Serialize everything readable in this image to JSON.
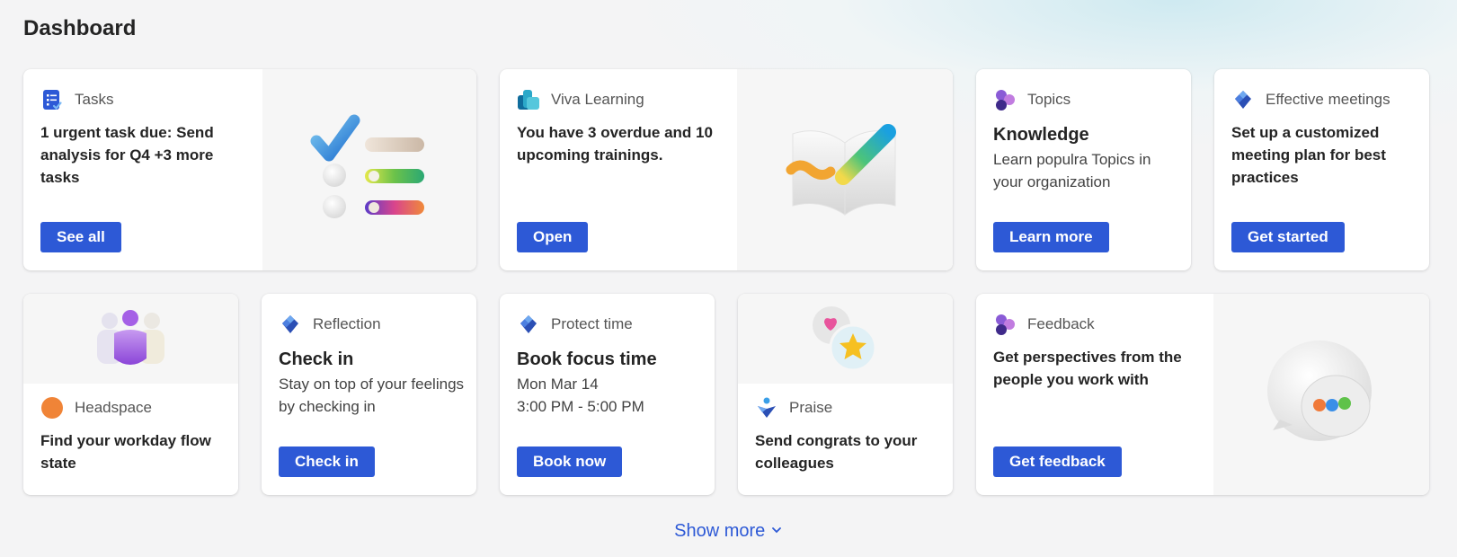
{
  "page": {
    "title": "Dashboard",
    "show_more": "Show more"
  },
  "colors": {
    "accent": "#2d59d6",
    "background": "#f4f4f5"
  },
  "cards": {
    "tasks": {
      "icon": "tasks-checklist-icon",
      "label": "Tasks",
      "text": "1 urgent task due: Send analysis for Q4 +3 more tasks",
      "button": "See all"
    },
    "viva": {
      "icon": "viva-learning-icon",
      "label": "Viva Learning",
      "text": "You have 3 overdue and 10 upcoming trainings.",
      "button": "Open"
    },
    "topics": {
      "icon": "topics-icon",
      "label": "Topics",
      "heading": "Knowledge",
      "text": "Learn populra Topics in your organization",
      "button": "Learn more"
    },
    "meetings": {
      "icon": "viva-insights-icon",
      "label": "Effective meetings",
      "text": "Set up a customized meeting plan for best practices",
      "button": "Get started"
    },
    "headspace": {
      "icon": "headspace-icon",
      "label": "Headspace",
      "text": "Find your workday flow state"
    },
    "reflection": {
      "icon": "viva-insights-icon",
      "label": "Reflection",
      "heading": "Check in",
      "text": "Stay on top of your feelings by checking in",
      "button": "Check in"
    },
    "protect": {
      "icon": "viva-insights-icon",
      "label": "Protect time",
      "heading": "Book focus time",
      "date": "Mon Mar 14",
      "time": "3:00 PM - 5:00 PM",
      "button": "Book now"
    },
    "praise": {
      "icon": "praise-icon",
      "label": "Praise",
      "text": "Send congrats to your colleagues"
    },
    "feedback": {
      "icon": "topics-icon",
      "label": "Feedback",
      "text": "Get perspectives from the people you work with",
      "button": "Get feedback"
    }
  }
}
